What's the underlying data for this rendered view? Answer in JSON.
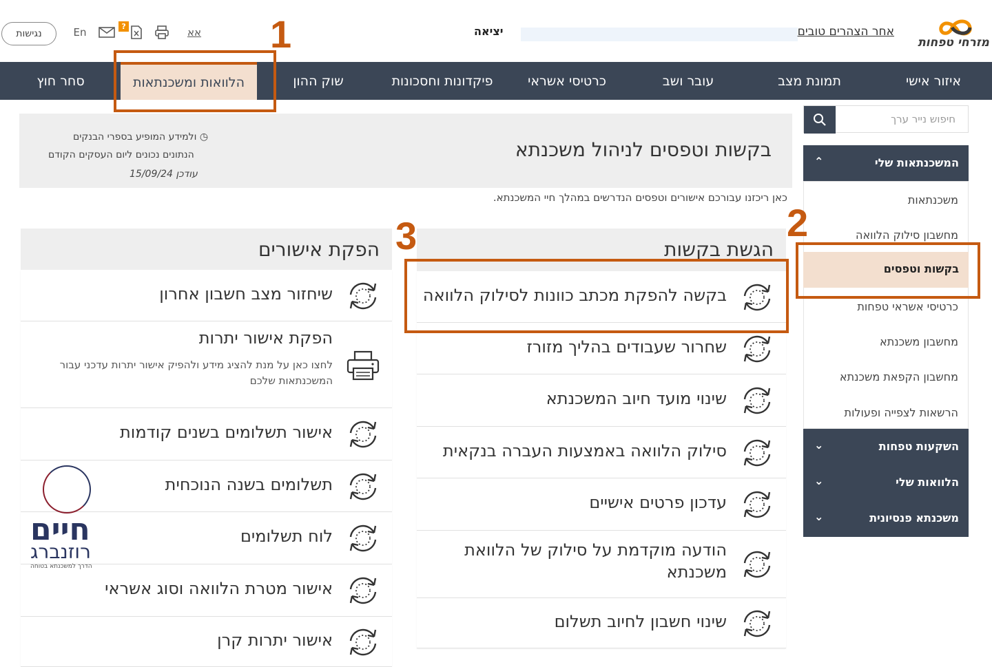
{
  "header": {
    "brand_name": "מזרחי טפחות",
    "greeting": "אחר הצהרים טובים",
    "logout": "יציאה",
    "tools": {
      "text_size": "אא",
      "print": "print-icon",
      "doc": "document-icon",
      "help_badge": "?",
      "mail": "mail-icon",
      "lang": "En"
    },
    "accessibility": "נגישות"
  },
  "nav": {
    "items": [
      "איזור אישי",
      "תמונת מצב",
      "עובר ושב",
      "כרטיסי אשראי",
      "פיקדונות וחסכונות",
      "שוק ההון",
      "הלוואות ומשכנתאות",
      "סחר חוץ"
    ],
    "active_index": 6
  },
  "sidebar": {
    "search_placeholder": "חיפוש נייר ערך",
    "group_open": "המשכנתאות שלי",
    "items": [
      "משכנתאות",
      "מחשבון סילוק הלוואה",
      "בקשות וטפסים",
      "כרטיסי אשראי טפחות",
      "מחשבון משכנתא",
      "מחשבון הקפאת משכנתא",
      "הרשאות לצפייה ופעולות"
    ],
    "active_index": 2,
    "groups_closed": [
      "השקעות טפחות",
      "הלוואות שלי",
      "משכנתא פנסיונית"
    ]
  },
  "page": {
    "title": "בקשות וטפסים לניהול משכנתא",
    "info_line1": "ולמידע המופיע בספרי הבנקים",
    "info_line2": "הנתונים נכונים ליום העסקים הקודם",
    "info_line3": "עודכן 15/09/24",
    "subtitle": "כאן ריכזנו עבורכם אישורים וטפסים הנדרשים במהלך חיי המשכנתא."
  },
  "requests": {
    "title": "הגשת בקשות",
    "items": [
      "בקשה להפקת מכתב כוונות לסילוק הלוואה",
      "שחרור שעבודים בהליך מזורז",
      "שינוי מועד חיוב המשכנתא",
      "סילוק הלוואה באמצעות העברה בנקאית",
      "עדכון פרטים אישיים",
      "הודעה מוקדמת על סילוק של הלוואת משכנתא",
      "שינוי חשבון לחיוב תשלום"
    ]
  },
  "approvals": {
    "title": "הפקת אישורים",
    "items": [
      {
        "label": "שיחזור מצב חשבון אחרון",
        "icon": "refresh-icon"
      },
      {
        "label": "הפקת אישור יתרות",
        "icon": "printer-icon",
        "desc": "לחצו כאן על מנת להציג מידע ולהפיק אישור יתרות עדכני עבור המשכנתאות שלכם"
      },
      {
        "label": "אישור תשלומים בשנים קודמות",
        "icon": "refresh-icon"
      },
      {
        "label": "תשלומים בשנה הנוכחית",
        "icon": "refresh-icon"
      },
      {
        "label": "לוח תשלומים",
        "icon": "refresh-icon"
      },
      {
        "label": "אישור מטרת הלוואה וסוג אשראי",
        "icon": "refresh-icon"
      },
      {
        "label": "אישור יתרות קרן",
        "icon": "refresh-icon"
      }
    ]
  },
  "annotations": {
    "n1": "1",
    "n2": "2",
    "n3": "3"
  },
  "watermark": {
    "name": "חיים",
    "surname": "רוזנברג",
    "tagline": "הדרך למשכנתא בטוחה"
  },
  "colors": {
    "nav_bg": "#3b4656",
    "accent": "#c55a11",
    "active_bg": "#f3dfcf"
  }
}
